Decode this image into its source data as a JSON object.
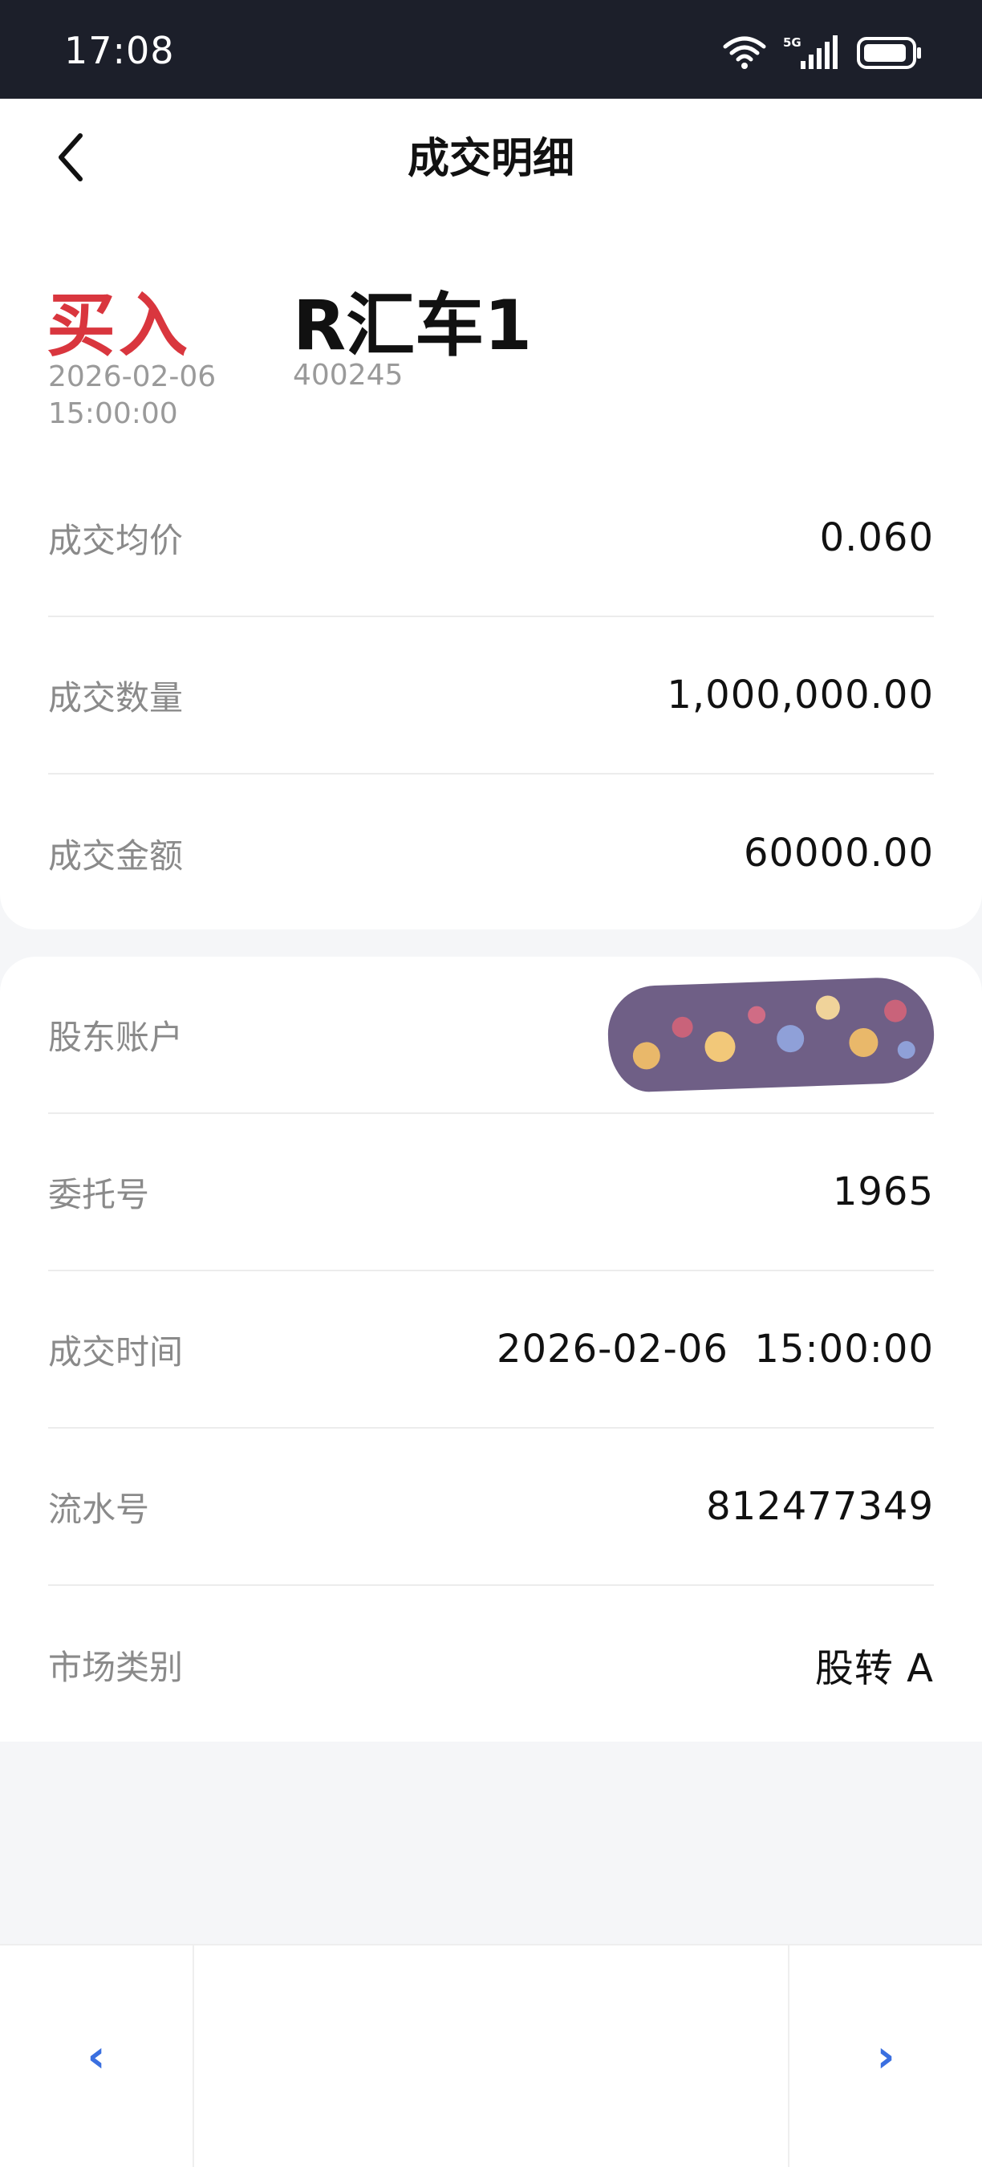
{
  "status_bar": {
    "time": "17:08",
    "icons": [
      "wifi-icon",
      "signal-5g-icon",
      "battery-icon"
    ],
    "network_label": "5G",
    "wifi_label": "6"
  },
  "nav": {
    "title": "成交明细",
    "back_icon": "chevron-left-icon"
  },
  "trade": {
    "type": "买入",
    "type_color": "#d9363e",
    "date": "2026-02-06",
    "time": "15:00:00",
    "stock_name": "R汇车1",
    "stock_code": "400245"
  },
  "summary": [
    {
      "label": "成交均价",
      "value": "0.060"
    },
    {
      "label": "成交数量",
      "value": "1,000,000.00"
    },
    {
      "label": "成交金额",
      "value": "60000.00"
    }
  ],
  "details": [
    {
      "label": "股东账户",
      "value": ""
    },
    {
      "label": "委托号",
      "value": "1965"
    },
    {
      "label": "成交时间",
      "value": "2026-02-06  15:00:00"
    },
    {
      "label": "流水号",
      "value": "812477349"
    },
    {
      "label": "市场类别",
      "value": "股转 A"
    }
  ],
  "pager": {
    "prev_symbol": "‹",
    "next_symbol": "›",
    "accent": "#3a6fe0"
  }
}
